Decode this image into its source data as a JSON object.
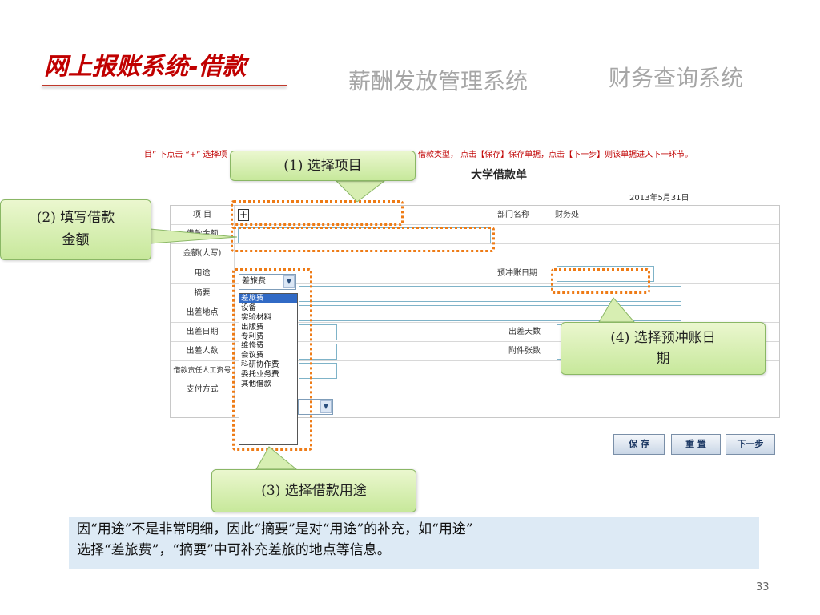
{
  "header": {
    "title": "网上报账系统-借款",
    "nav_salary": "薪酬发放管理系统",
    "nav_finance": "财务查询系统"
  },
  "instruction": {
    "left": "目” 下点击 “+” 选择项",
    "right": "借款类型， 点击【保存】保存单据，点击【下一步】则该单据进入下一环节。"
  },
  "form": {
    "title": "大学借款单",
    "date": "2013年5月31日",
    "labels": {
      "project": "项  目",
      "amount": "借款金额",
      "amount_caps": "金额(大写)",
      "purpose": "用途",
      "summary": "摘要",
      "location": "出差地点",
      "date": "出差日期",
      "people": "出差人数",
      "staff_id": "借款责任人工资号",
      "payment": "支付方式",
      "dept": "部门名称",
      "offset_date": "预冲账日期",
      "days": "出差天数",
      "attachments": "附件张数"
    },
    "project_add": "+",
    "dept_value": "财务处",
    "purpose_selected": "差旅费",
    "purpose_options": [
      "差旅费",
      "设备",
      "实验材料",
      "出版费",
      "专利费",
      "维修费",
      "会议费",
      "科研协作费",
      "委托业务费",
      "其他借款"
    ],
    "buttons": {
      "save": "保 存",
      "reset": "重 置",
      "next": "下一步"
    }
  },
  "callouts": {
    "c1": "(1) 选择项目",
    "c2_line1": "(2) 填写借款",
    "c2_line2": "金额",
    "c3": "(3) 选择借款用途",
    "c4_line1": "(4) 选择预冲账日",
    "c4_line2": "期"
  },
  "note": {
    "line1": "因“用途”不是非常明细，因此“摘要”是对“用途”的补充，如“用途”",
    "line2": "选择“差旅费”，“摘要”中可补充差旅的地点等信息。"
  },
  "page_number": "33"
}
